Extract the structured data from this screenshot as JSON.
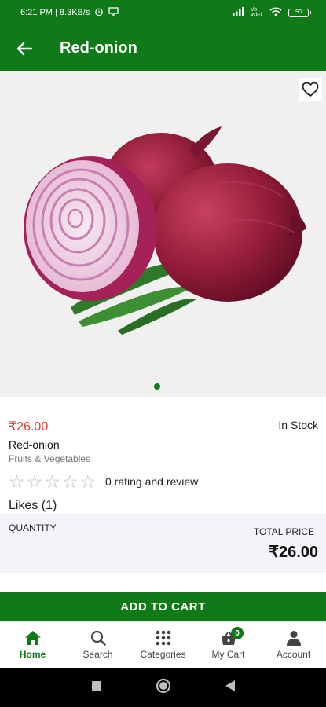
{
  "status_bar": {
    "time_speed": "6:21 PM | 8.3KB/s",
    "network": "Vo WiFi",
    "battery": "90"
  },
  "app_bar": {
    "title": "Red-onion"
  },
  "product": {
    "price": "₹26.00",
    "stock": "In Stock",
    "name": "Red-onion",
    "category": "Fruits & Vegetables",
    "rating_stars": 0,
    "rating_text": "0 rating and review",
    "likes": "Likes (1)",
    "image_page_current": 1,
    "image_page_total": 1
  },
  "quantity_panel": {
    "quantity_label": "QUANTITY",
    "total_price_label": "TOTAL PRICE",
    "total_price_value": "₹26.00"
  },
  "cart_button": {
    "label": "ADD TO CART"
  },
  "bottom_nav": {
    "items": [
      {
        "label": "Home",
        "icon": "home-icon",
        "active": true
      },
      {
        "label": "Search",
        "icon": "search-icon",
        "active": false
      },
      {
        "label": "Categories",
        "icon": "grid-icon",
        "active": false
      },
      {
        "label": "My Cart",
        "icon": "cart-icon",
        "active": false,
        "badge": "0"
      },
      {
        "label": "Account",
        "icon": "person-icon",
        "active": false
      }
    ]
  },
  "colors": {
    "brand_green": "#0f7a17",
    "price_red": "#e0392d"
  }
}
